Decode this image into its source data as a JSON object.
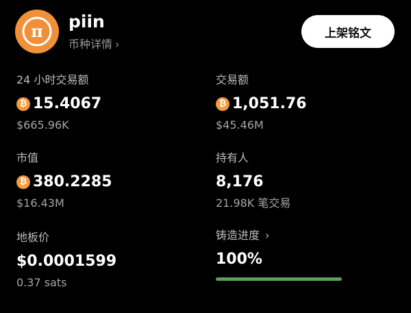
{
  "header": {
    "token_name": "piin",
    "detail_link_label": "币种详情",
    "logo_icon": "pi-logo-icon",
    "list_button_label": "上架铭文",
    "colors": {
      "logo_bg": "#f0913a",
      "button_bg": "#ffffff"
    }
  },
  "stats": {
    "volume_24h": {
      "label": "24 小时交易额",
      "value": "15.4067",
      "sub": "$665.96K",
      "icon": "bitcoin-icon"
    },
    "total_volume": {
      "label": "交易额",
      "value": "1,051.76",
      "sub": "$45.46M",
      "icon": "bitcoin-icon"
    },
    "market_cap": {
      "label": "市值",
      "value": "380.2285",
      "sub": "$16.43M",
      "icon": "bitcoin-icon"
    },
    "holders": {
      "label": "持有人",
      "value": "8,176",
      "sub": "21.98K 笔交易"
    },
    "floor_price": {
      "label": "地板价",
      "value": "$0.0001599",
      "sub": "0.37 sats"
    },
    "mint_progress": {
      "label": "铸造进度",
      "value": "100%",
      "progress": 1.0,
      "progress_color": "#5aa35a"
    }
  },
  "btc_symbol": "₿"
}
